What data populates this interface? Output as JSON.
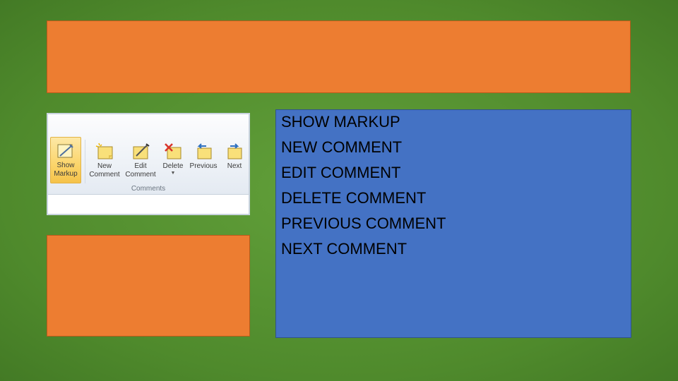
{
  "ribbon": {
    "buttons": [
      {
        "label_line1": "Show",
        "label_line2": "Markup",
        "icon": "show-markup-icon"
      },
      {
        "label_line1": "New",
        "label_line2": "Comment",
        "icon": "new-comment-icon"
      },
      {
        "label_line1": "Edit",
        "label_line2": "Comment",
        "icon": "edit-comment-icon"
      },
      {
        "label_line1": "Delete",
        "label_line2": "",
        "icon": "delete-comment-icon"
      },
      {
        "label_line1": "Previous",
        "label_line2": "",
        "icon": "previous-comment-icon"
      },
      {
        "label_line1": "Next",
        "label_line2": "",
        "icon": "next-comment-icon"
      }
    ],
    "group_label": "Comments"
  },
  "content": {
    "items": [
      "SHOW MARKUP",
      "NEW COMMENT",
      "EDIT COMMENT",
      "DELETE COMMENT",
      "PREVIOUS COMMENT",
      "NEXT COMMENT"
    ]
  },
  "colors": {
    "background": "#5a9535",
    "accent_orange": "#ed7d31",
    "accent_blue": "#4472c4",
    "active_button": "#fbd56b"
  }
}
